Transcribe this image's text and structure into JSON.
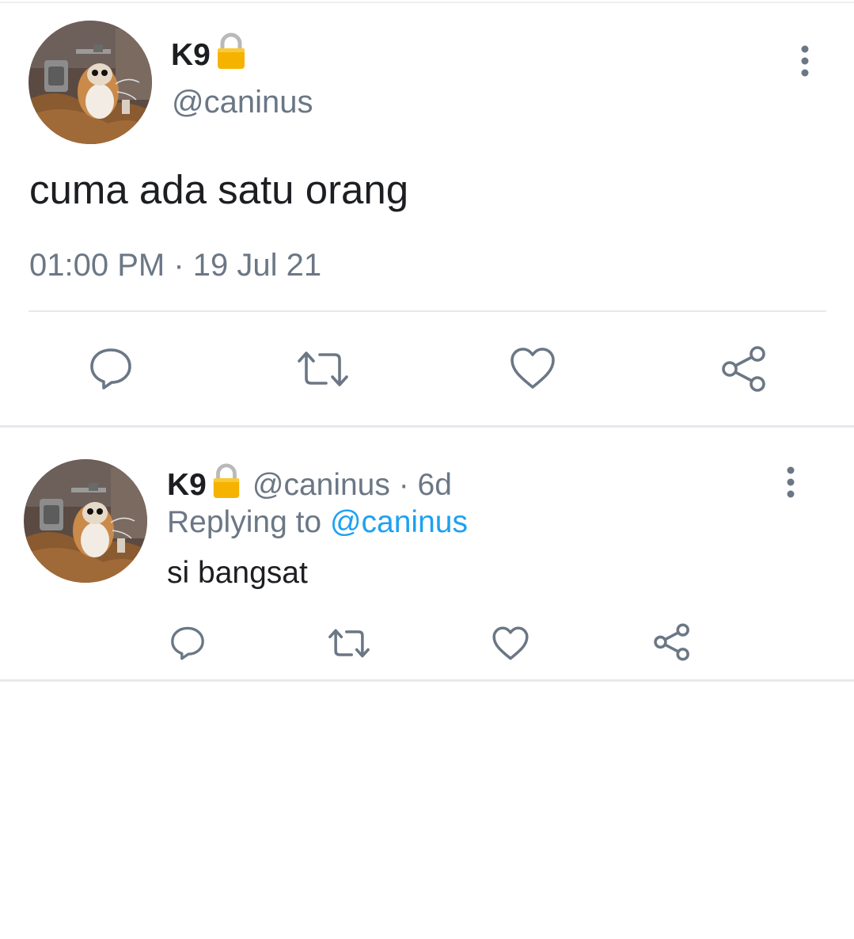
{
  "main_tweet": {
    "display_name": "K9",
    "handle": "@caninus",
    "text": "cuma ada satu orang",
    "time": "01:00 PM",
    "separator": " · ",
    "date": "19 Jul 21",
    "avatar": "porg-avatar",
    "protected_icon": "lock-icon"
  },
  "reply_tweet": {
    "display_name": "K9",
    "handle": "@caninus",
    "age": "6d",
    "separator": " · ",
    "replying_prefix": "Replying to ",
    "replying_to": "@caninus",
    "text": "si bangsat",
    "avatar": "porg-avatar",
    "protected_icon": "lock-icon"
  },
  "actions": [
    "reply-icon",
    "retweet-icon",
    "like-icon",
    "share-icon"
  ],
  "colors": {
    "text": "#1c1e21",
    "secondary": "#6b7785",
    "link": "#1da1f2",
    "divider": "#e6e9ec",
    "icon": "#6b7785",
    "lock": "#f5b300"
  }
}
